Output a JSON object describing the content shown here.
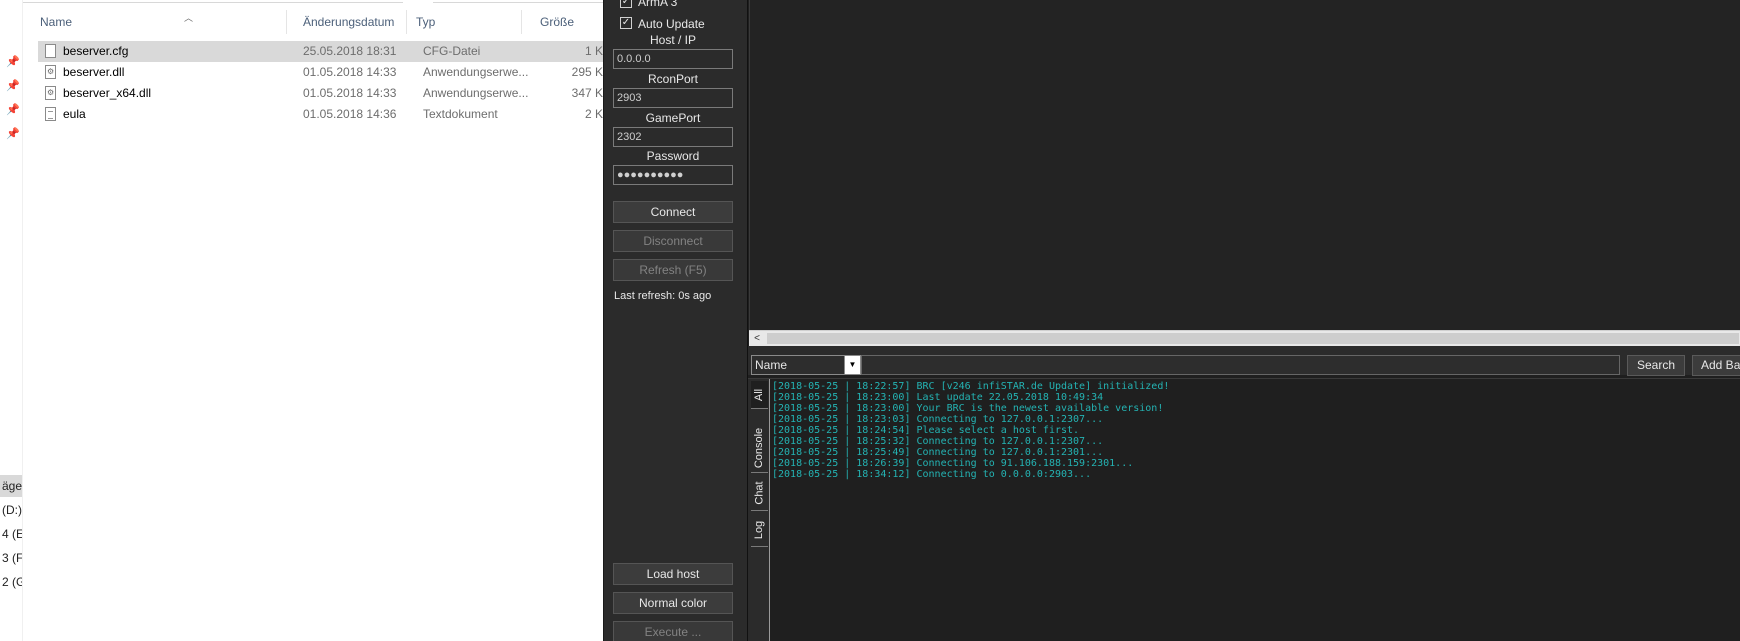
{
  "explorer": {
    "columns": {
      "name": "Name",
      "date": "Änderungsdatum",
      "type": "Typ",
      "size": "Größe"
    },
    "files": [
      {
        "name": "beserver.cfg",
        "date": "25.05.2018 18:31",
        "type": "CFG-Datei",
        "size": "1 K",
        "icon": "file-icon"
      },
      {
        "name": "beserver.dll",
        "date": "01.05.2018 14:33",
        "type": "Anwendungserwe...",
        "size": "295 K",
        "icon": "dll-icon"
      },
      {
        "name": "beserver_x64.dll",
        "date": "01.05.2018 14:33",
        "type": "Anwendungserwe...",
        "size": "347 K",
        "icon": "dll-icon"
      },
      {
        "name": "eula",
        "date": "01.05.2018 14:36",
        "type": "Textdokument",
        "size": "2 K",
        "icon": "text-file-icon"
      }
    ],
    "nav_items": [
      "äger",
      "(D:)",
      "4 (E",
      "3 (F",
      "2 (G"
    ]
  },
  "side_panel": {
    "game_checkbox_label": "ArmA 3",
    "auto_update_label": "Auto Update",
    "host_label": "Host / IP",
    "host_value": "0.0.0.0",
    "rcon_port_label": "RconPort",
    "rcon_port_value": "2903",
    "game_port_label": "GamePort",
    "game_port_value": "2302",
    "password_label": "Password",
    "password_value": "●●●●●●●●●●",
    "connect_label": "Connect",
    "disconnect_label": "Disconnect",
    "refresh_label": "Refresh (F5)",
    "last_refresh": "Last refresh: 0s ago",
    "load_host_label": "Load host",
    "normal_color_label": "Normal color",
    "execute_label": "Execute ..."
  },
  "search": {
    "field_select_value": "Name",
    "input_value": "",
    "search_label": "Search",
    "add_ban_label": "Add Ba"
  },
  "log_tabs": [
    "All",
    "Console",
    "Chat",
    "Log"
  ],
  "log_lines": [
    "[2018-05-25 | 18:22:57] BRC [v246 infiSTAR.de Update] initialized!",
    "[2018-05-25 | 18:23:00] Last update 22.05.2018 10:49:34",
    "[2018-05-25 | 18:23:00] Your BRC is the newest available version!",
    "[2018-05-25 | 18:23:03] Connecting to 127.0.0.1:2307...",
    "[2018-05-25 | 18:24:54] Please select a host first.",
    "[2018-05-25 | 18:25:32] Connecting to 127.0.0.1:2307...",
    "[2018-05-25 | 18:25:49] Connecting to 127.0.0.1:2301...",
    "[2018-05-25 | 18:26:39] Connecting to 91.106.188.159:2301...",
    "[2018-05-25 | 18:34:12] Connecting to 0.0.0.0:2903..."
  ],
  "colors": {
    "log_text": "#24b3b3",
    "panel_bg": "#2b2b2b",
    "selection": "#d9d9d9"
  }
}
